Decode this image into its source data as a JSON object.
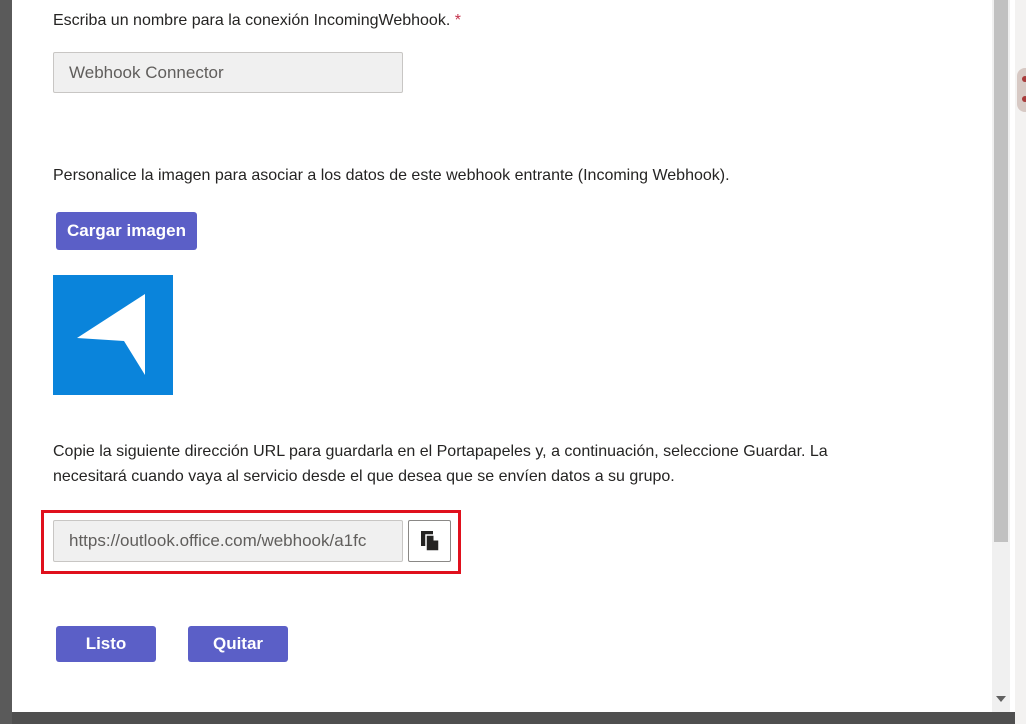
{
  "dialog": {
    "name_prompt": "Escriba un nombre para la conexión IncomingWebhook.",
    "required_marker": "*",
    "name_value": "Webhook Connector",
    "image_prompt": "Personalice la imagen para asociar a los datos de este webhook entrante (Incoming Webhook).",
    "upload_button": "Cargar imagen",
    "logo_icon": "send-arrow-icon",
    "url_prompt_line1": "Copie la siguiente dirección URL para guardarla en el Portapapeles y, a continuación, seleccione Guardar. La",
    "url_prompt_line2": "necesitará cuando vaya al servicio desde el que desea que se envíen datos a su grupo.",
    "url_value": "https://outlook.office.com/webhook/a1fc",
    "copy_icon": "copy-icon",
    "done_button": "Listo",
    "remove_button": "Quitar"
  },
  "colors": {
    "accent": "#5b5fc7",
    "logo_bg": "#0a84db",
    "highlight": "#e0101d",
    "required": "#c4314b"
  }
}
